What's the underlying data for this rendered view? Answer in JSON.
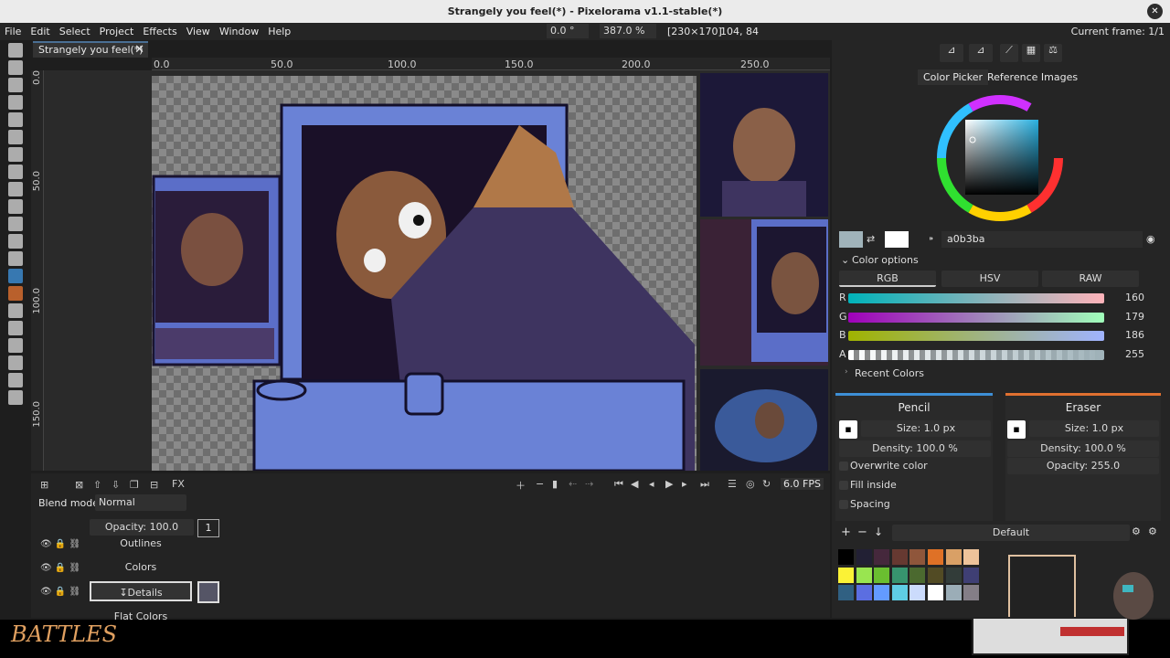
{
  "window": {
    "title": "Strangely you feel(*) - Pixelorama v1.1-stable(*)",
    "close_icon": "close-icon"
  },
  "menu": {
    "items": [
      "File",
      "Edit",
      "Select",
      "Project",
      "Effects",
      "View",
      "Window",
      "Help"
    ]
  },
  "statusbar": {
    "rotation": "0.0 °",
    "zoom": "387.0 %",
    "canvas_size": "[230×170]",
    "cursor_pos": "104, 84",
    "current_frame": "Current frame: 1/1"
  },
  "tab": {
    "label": "Strangely you feel(*)"
  },
  "ruler": {
    "h_labels": [
      "0.0",
      "50.0",
      "100.0",
      "150.0",
      "200.0",
      "250.0"
    ],
    "v_labels": [
      "0.0",
      "50.0",
      "100.0",
      "150.0"
    ]
  },
  "right_panel": {
    "tabs": [
      "Color Picker",
      "Reference Images"
    ],
    "hex": "a0b3ba",
    "color_options_label": "Color options",
    "modes": [
      "RGB",
      "HSV",
      "RAW"
    ],
    "sliders": [
      {
        "label": "R",
        "value": "160"
      },
      {
        "label": "G",
        "value": "179"
      },
      {
        "label": "B",
        "value": "186"
      },
      {
        "label": "A",
        "value": "255"
      }
    ],
    "recent_colors": "Recent Colors",
    "pencil": {
      "name": "Pencil",
      "size": "Size: 1.0 px",
      "density": "Density: 100.0 %",
      "overwrite": "Overwrite color",
      "fill_inside": "Fill inside",
      "spacing": "Spacing",
      "color": "#3d8fd6"
    },
    "eraser": {
      "name": "Eraser",
      "size": "Size: 1.0 px",
      "density": "Density: 100.0 %",
      "opacity": "Opacity: 255.0",
      "color": "#e07030"
    },
    "palette": {
      "name": "Default",
      "colors": [
        "#000000",
        "#222034",
        "#45283c",
        "#663931",
        "#8f563b",
        "#df7126",
        "#d9a066",
        "#eec39a",
        "#fbf236",
        "#99e550",
        "#6abe30",
        "#37946e",
        "#4b692f",
        "#524b24",
        "#323c39",
        "#3f3f74",
        "#306082",
        "#5b6ee1",
        "#639bff",
        "#5fcde4",
        "#cbdbfc",
        "#ffffff",
        "#9badb7",
        "#847e87"
      ]
    }
  },
  "timeline": {
    "blend_label": "Blend mode:",
    "blend_value": "Normal",
    "opacity": "Opacity: 100.0",
    "fps": "6.0 FPS",
    "frame_number": "1",
    "layers": [
      {
        "name": "Outlines"
      },
      {
        "name": "Colors"
      },
      {
        "name": "↧Details"
      },
      {
        "name": "Flat Colors"
      }
    ]
  },
  "overlay": {
    "signature": "BATTLES"
  }
}
